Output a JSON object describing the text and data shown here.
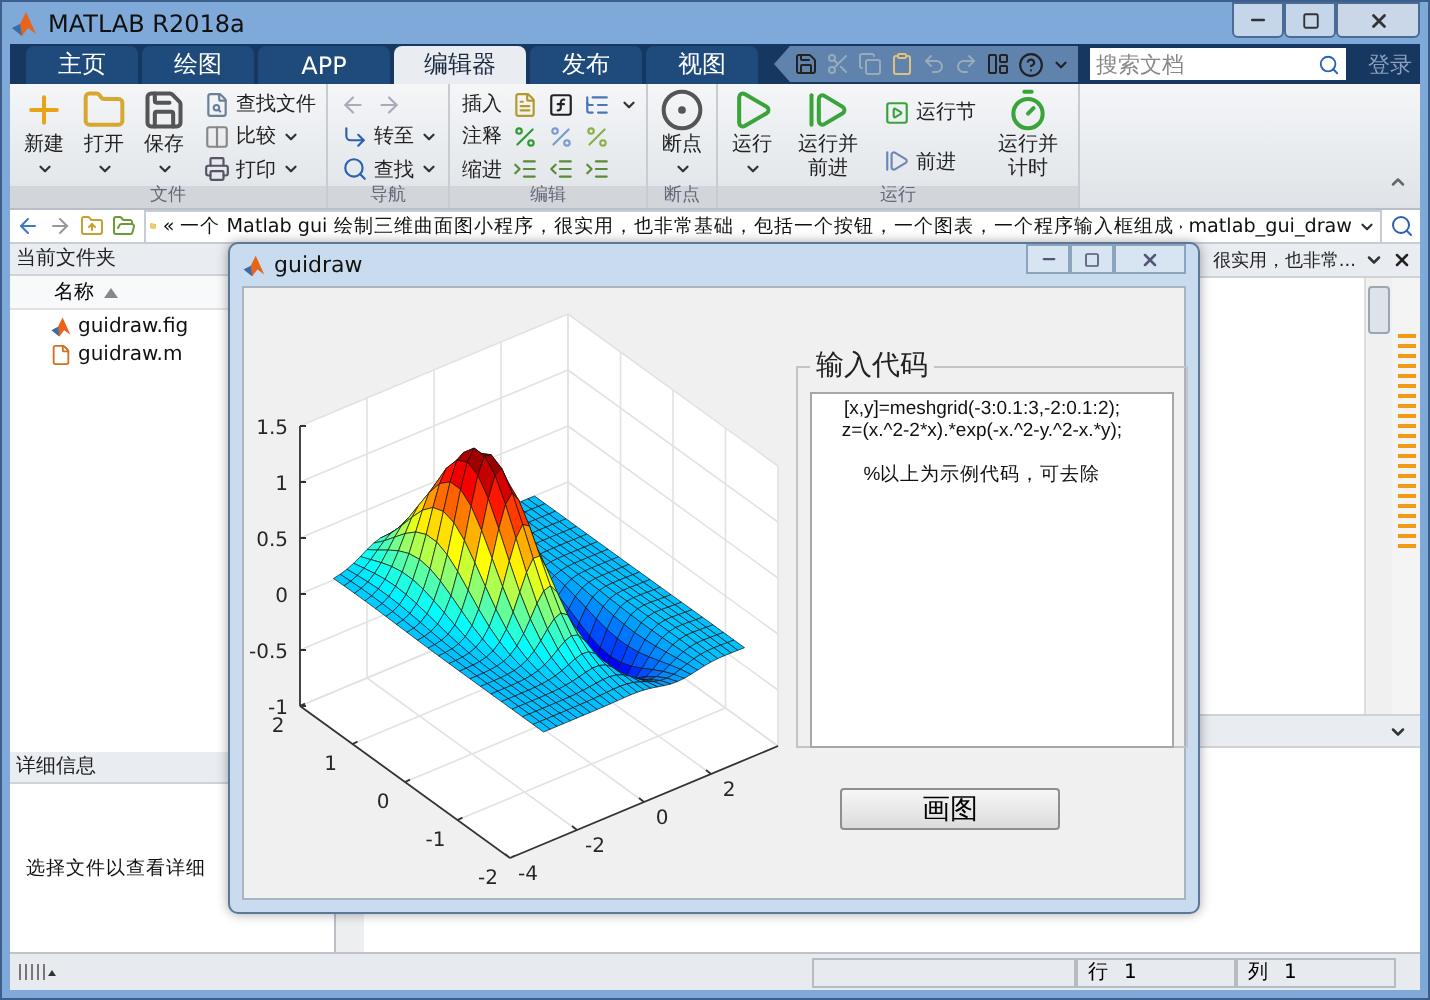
{
  "window": {
    "title": "MATLAB R2018a"
  },
  "tabs": [
    {
      "label": "主页",
      "selected": false
    },
    {
      "label": "绘图",
      "selected": false
    },
    {
      "label": "APP",
      "selected": false
    },
    {
      "label": "编辑器",
      "selected": true
    },
    {
      "label": "发布",
      "selected": false
    },
    {
      "label": "视图",
      "selected": false
    }
  ],
  "search": {
    "placeholder": "搜索文档"
  },
  "sign_in": "登录",
  "ribbon": [
    {
      "label": "文件",
      "items": [
        {
          "kind": "large",
          "label": "新建",
          "dropdown": true
        },
        {
          "kind": "large",
          "label": "打开",
          "dropdown": true
        },
        {
          "kind": "large",
          "label": "保存",
          "dropdown": true
        },
        {
          "kind": "small",
          "label": "查找文件",
          "dropdown": false
        },
        {
          "kind": "small",
          "label": "比较",
          "dropdown": true
        },
        {
          "kind": "small",
          "label": "打印",
          "dropdown": true
        }
      ]
    },
    {
      "label": "导航",
      "items": [
        {
          "kind": "arrows"
        },
        {
          "kind": "small",
          "label": "转至",
          "dropdown": true
        },
        {
          "kind": "small",
          "label": "查找",
          "dropdown": true
        }
      ]
    },
    {
      "label": "编辑",
      "items": [
        {
          "kind": "iconrow",
          "label": "插入",
          "dropdown": true
        },
        {
          "kind": "iconrow",
          "label": "注释",
          "dropdown": false
        },
        {
          "kind": "iconrow",
          "label": "缩进",
          "dropdown": false
        }
      ]
    },
    {
      "label": "断点",
      "items": [
        {
          "kind": "large",
          "label": "断点",
          "dropdown": true
        }
      ]
    },
    {
      "label": "运行",
      "items": [
        {
          "kind": "large",
          "label": "运行",
          "dropdown": true
        },
        {
          "kind": "large",
          "label": "运行并前进",
          "dropdown": false
        },
        {
          "kind": "small",
          "label": "运行节",
          "dropdown": false
        },
        {
          "kind": "small",
          "label": "前进",
          "dropdown": false
        },
        {
          "kind": "large",
          "label": "运行并计时",
          "dropdown": false
        }
      ]
    }
  ],
  "address_bar": {
    "prefix": "«",
    "segments": [
      "一个 Matlab gui 绘制三维曲面图小程序，很实用，也非常基础，包括一个按钮，一个图表，一个程序输入框组成",
      "matlab_gui_draw"
    ]
  },
  "current_folder": {
    "title": "当前文件夹",
    "column": "名称",
    "files": [
      {
        "name": "guidraw.fig",
        "kind": "fig"
      },
      {
        "name": "guidraw.m",
        "kind": "m"
      }
    ]
  },
  "details": {
    "title": "详细信息",
    "message": "选择文件以查看详细"
  },
  "editor": {
    "tab": "很实用，也非常..."
  },
  "status_bar": {
    "line": "行",
    "line_value": "1",
    "column": "列",
    "column_value": "1"
  },
  "figure": {
    "title": "guidraw",
    "axes": {
      "z_ticks": [
        "1.5",
        "1",
        "0.5",
        "0",
        "-0.5",
        "-1"
      ],
      "y_ticks": [
        "2",
        "1",
        "0",
        "-1",
        "-2"
      ],
      "x_ticks": [
        "-4",
        "-2",
        "0",
        "2"
      ]
    },
    "code_panel": {
      "title": "输入代码",
      "value": "[x,y]=meshgrid(-3:0.1:3,-2:0.1:2);\nz=(x.^2-2*x).*exp(-x.^2-y.^2-x.*y);\n\n%以上为示例代码，可去除"
    },
    "button": "画图"
  }
}
